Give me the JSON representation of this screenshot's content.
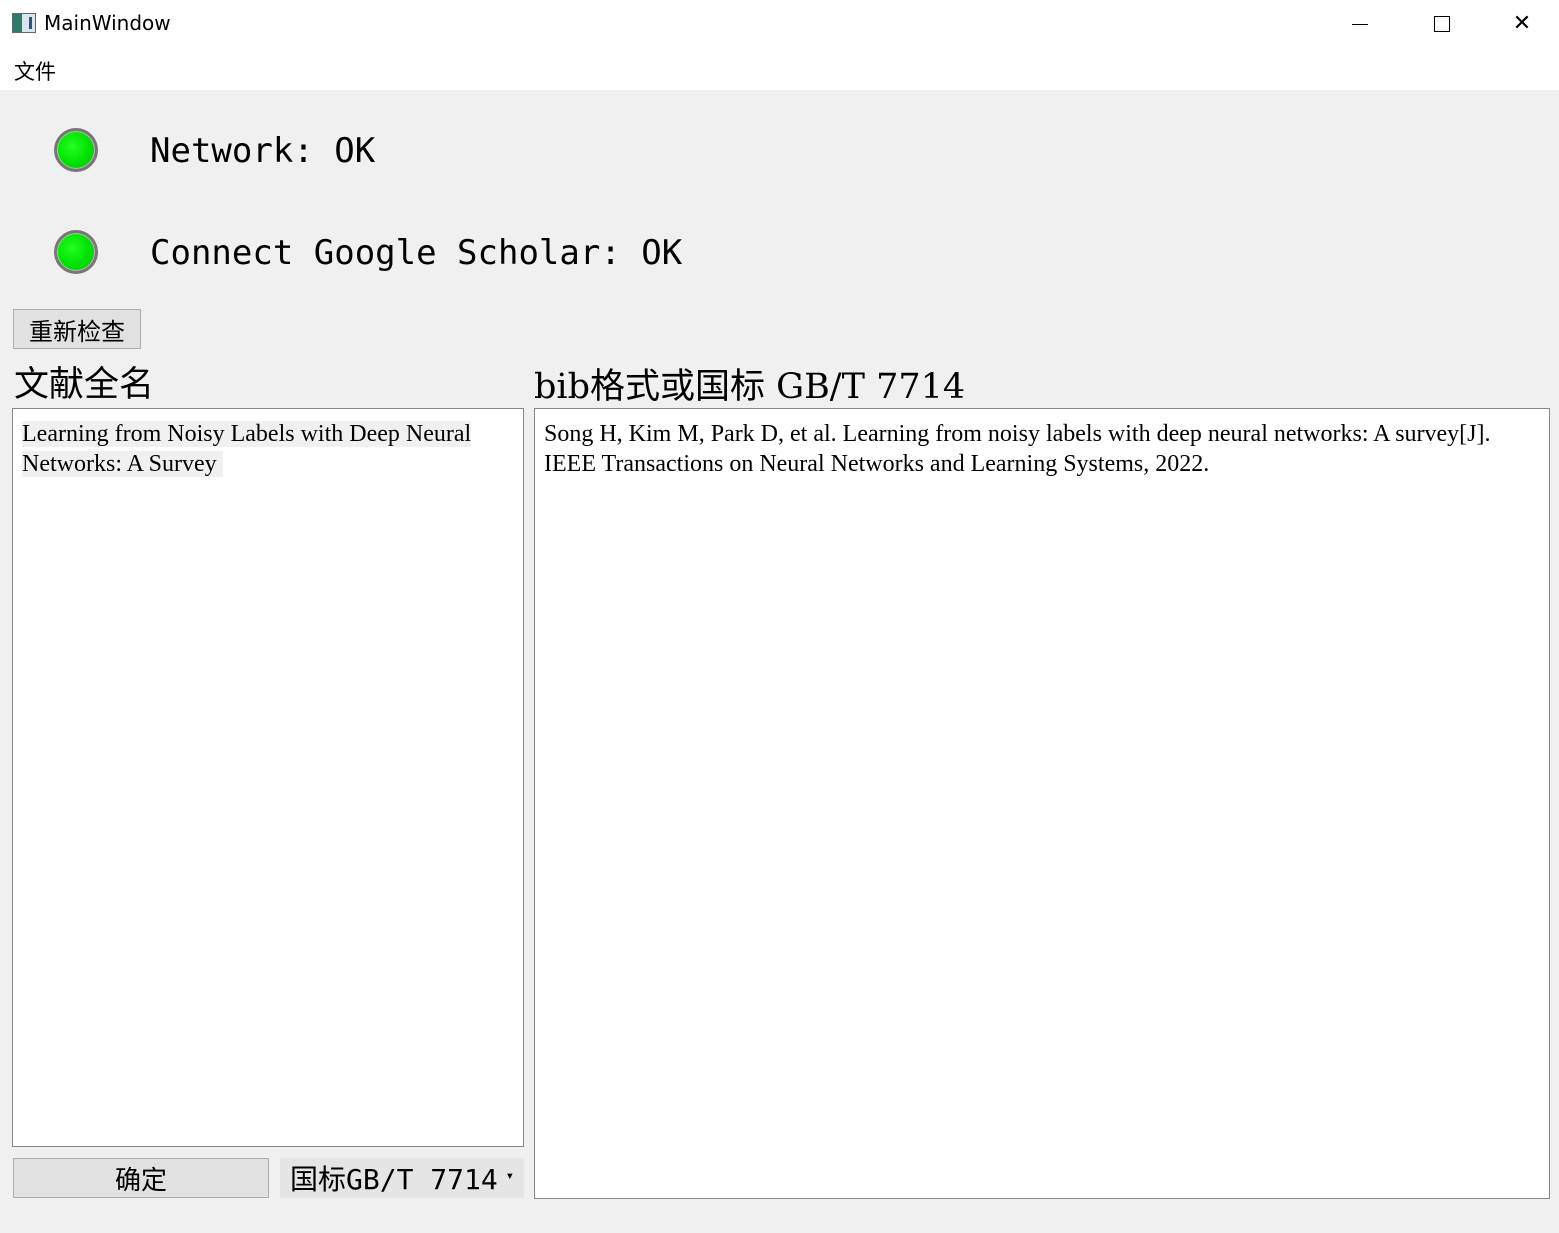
{
  "window": {
    "title": "MainWindow"
  },
  "menu": {
    "file_label": "文件"
  },
  "status": {
    "network_text": "Network: OK",
    "scholar_text": "Connect Google Scholar: OK",
    "led_color": "#00e000"
  },
  "buttons": {
    "recheck_label": "重新检查",
    "confirm_label": "确定"
  },
  "labels": {
    "title_input_label": "文献全名",
    "output_label": "bib格式或国标 GB/T 7714"
  },
  "input": {
    "title_value": "Learning from Noisy Labels with Deep Neural Networks: A Survey"
  },
  "output": {
    "citation_value": "Song H, Kim M, Park D, et al. Learning from noisy labels with deep neural networks: A survey[J]. IEEE Transactions on Neural Networks and Learning Systems, 2022."
  },
  "format_select": {
    "selected": "国标GB/T 7714"
  },
  "icons": {
    "app": "app-icon",
    "minimize": "minimize-icon",
    "maximize": "maximize-icon",
    "close": "close-icon",
    "dropdown": "chevron-down-icon"
  }
}
